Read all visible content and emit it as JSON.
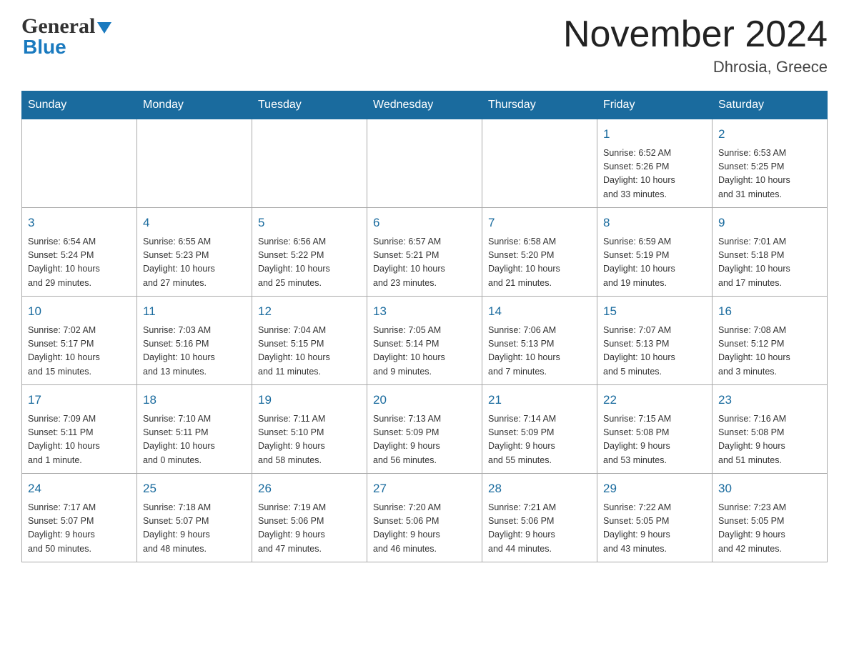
{
  "header": {
    "logo_general": "General",
    "logo_blue": "Blue",
    "month_title": "November 2024",
    "location": "Dhrosia, Greece"
  },
  "calendar": {
    "days_of_week": [
      "Sunday",
      "Monday",
      "Tuesday",
      "Wednesday",
      "Thursday",
      "Friday",
      "Saturday"
    ],
    "weeks": [
      [
        {
          "day": "",
          "info": ""
        },
        {
          "day": "",
          "info": ""
        },
        {
          "day": "",
          "info": ""
        },
        {
          "day": "",
          "info": ""
        },
        {
          "day": "",
          "info": ""
        },
        {
          "day": "1",
          "info": "Sunrise: 6:52 AM\nSunset: 5:26 PM\nDaylight: 10 hours\nand 33 minutes."
        },
        {
          "day": "2",
          "info": "Sunrise: 6:53 AM\nSunset: 5:25 PM\nDaylight: 10 hours\nand 31 minutes."
        }
      ],
      [
        {
          "day": "3",
          "info": "Sunrise: 6:54 AM\nSunset: 5:24 PM\nDaylight: 10 hours\nand 29 minutes."
        },
        {
          "day": "4",
          "info": "Sunrise: 6:55 AM\nSunset: 5:23 PM\nDaylight: 10 hours\nand 27 minutes."
        },
        {
          "day": "5",
          "info": "Sunrise: 6:56 AM\nSunset: 5:22 PM\nDaylight: 10 hours\nand 25 minutes."
        },
        {
          "day": "6",
          "info": "Sunrise: 6:57 AM\nSunset: 5:21 PM\nDaylight: 10 hours\nand 23 minutes."
        },
        {
          "day": "7",
          "info": "Sunrise: 6:58 AM\nSunset: 5:20 PM\nDaylight: 10 hours\nand 21 minutes."
        },
        {
          "day": "8",
          "info": "Sunrise: 6:59 AM\nSunset: 5:19 PM\nDaylight: 10 hours\nand 19 minutes."
        },
        {
          "day": "9",
          "info": "Sunrise: 7:01 AM\nSunset: 5:18 PM\nDaylight: 10 hours\nand 17 minutes."
        }
      ],
      [
        {
          "day": "10",
          "info": "Sunrise: 7:02 AM\nSunset: 5:17 PM\nDaylight: 10 hours\nand 15 minutes."
        },
        {
          "day": "11",
          "info": "Sunrise: 7:03 AM\nSunset: 5:16 PM\nDaylight: 10 hours\nand 13 minutes."
        },
        {
          "day": "12",
          "info": "Sunrise: 7:04 AM\nSunset: 5:15 PM\nDaylight: 10 hours\nand 11 minutes."
        },
        {
          "day": "13",
          "info": "Sunrise: 7:05 AM\nSunset: 5:14 PM\nDaylight: 10 hours\nand 9 minutes."
        },
        {
          "day": "14",
          "info": "Sunrise: 7:06 AM\nSunset: 5:13 PM\nDaylight: 10 hours\nand 7 minutes."
        },
        {
          "day": "15",
          "info": "Sunrise: 7:07 AM\nSunset: 5:13 PM\nDaylight: 10 hours\nand 5 minutes."
        },
        {
          "day": "16",
          "info": "Sunrise: 7:08 AM\nSunset: 5:12 PM\nDaylight: 10 hours\nand 3 minutes."
        }
      ],
      [
        {
          "day": "17",
          "info": "Sunrise: 7:09 AM\nSunset: 5:11 PM\nDaylight: 10 hours\nand 1 minute."
        },
        {
          "day": "18",
          "info": "Sunrise: 7:10 AM\nSunset: 5:11 PM\nDaylight: 10 hours\nand 0 minutes."
        },
        {
          "day": "19",
          "info": "Sunrise: 7:11 AM\nSunset: 5:10 PM\nDaylight: 9 hours\nand 58 minutes."
        },
        {
          "day": "20",
          "info": "Sunrise: 7:13 AM\nSunset: 5:09 PM\nDaylight: 9 hours\nand 56 minutes."
        },
        {
          "day": "21",
          "info": "Sunrise: 7:14 AM\nSunset: 5:09 PM\nDaylight: 9 hours\nand 55 minutes."
        },
        {
          "day": "22",
          "info": "Sunrise: 7:15 AM\nSunset: 5:08 PM\nDaylight: 9 hours\nand 53 minutes."
        },
        {
          "day": "23",
          "info": "Sunrise: 7:16 AM\nSunset: 5:08 PM\nDaylight: 9 hours\nand 51 minutes."
        }
      ],
      [
        {
          "day": "24",
          "info": "Sunrise: 7:17 AM\nSunset: 5:07 PM\nDaylight: 9 hours\nand 50 minutes."
        },
        {
          "day": "25",
          "info": "Sunrise: 7:18 AM\nSunset: 5:07 PM\nDaylight: 9 hours\nand 48 minutes."
        },
        {
          "day": "26",
          "info": "Sunrise: 7:19 AM\nSunset: 5:06 PM\nDaylight: 9 hours\nand 47 minutes."
        },
        {
          "day": "27",
          "info": "Sunrise: 7:20 AM\nSunset: 5:06 PM\nDaylight: 9 hours\nand 46 minutes."
        },
        {
          "day": "28",
          "info": "Sunrise: 7:21 AM\nSunset: 5:06 PM\nDaylight: 9 hours\nand 44 minutes."
        },
        {
          "day": "29",
          "info": "Sunrise: 7:22 AM\nSunset: 5:05 PM\nDaylight: 9 hours\nand 43 minutes."
        },
        {
          "day": "30",
          "info": "Sunrise: 7:23 AM\nSunset: 5:05 PM\nDaylight: 9 hours\nand 42 minutes."
        }
      ]
    ]
  }
}
